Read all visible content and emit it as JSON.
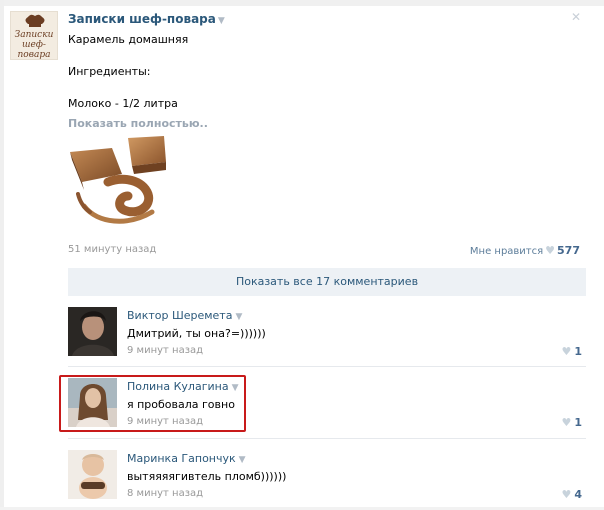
{
  "post": {
    "author": "Записки шеф-повара",
    "logo_text": "Записки шеф-повара",
    "text_line1": "Карамель домашняя",
    "text_line2": "Ингредиенты:",
    "text_line3": "Молоко - 1/2 литра",
    "show_more": "Показать полностью..",
    "time": "51 минуту назад",
    "like_label": "Мне нравится",
    "like_count": "577"
  },
  "comments_bar": {
    "label": "Показать все 17 комментариев"
  },
  "comments": [
    {
      "name": "Виктор Шеремета",
      "text": "Дмитрий, ты она?=))))))",
      "time": "9 минут назад",
      "likes": "1"
    },
    {
      "name": "Полина Кулагина",
      "text": "я пробовала говно",
      "time": "9 минут назад",
      "likes": "1"
    },
    {
      "name": "Маринка Гапончук",
      "text": "вытяяяягивтель пломб))))))",
      "time": "8 минут назад",
      "likes": "4"
    }
  ],
  "colors": {
    "link": "#2b587a",
    "muted": "#999999",
    "bar_bg": "#edf1f5",
    "highlight": "#c81a1a"
  }
}
